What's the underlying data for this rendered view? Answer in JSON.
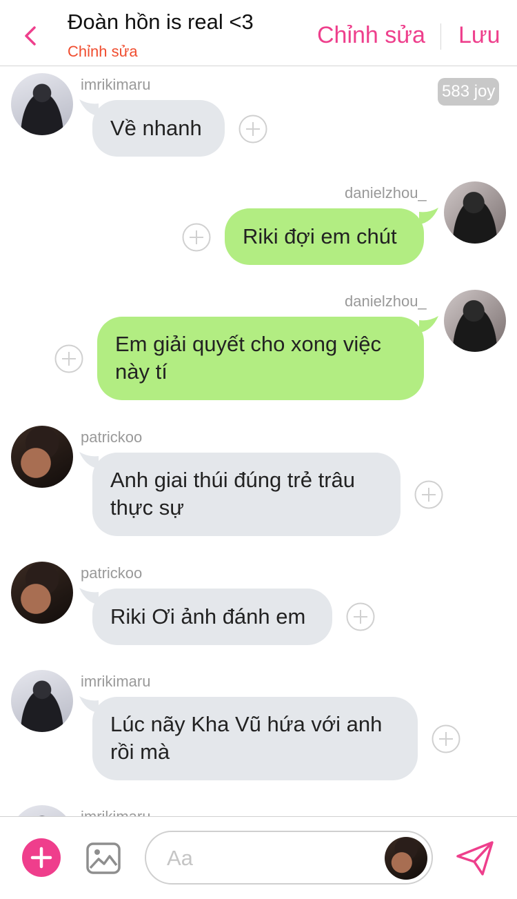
{
  "header": {
    "title": "Đoàn hồn is real <3",
    "subtitle": "Chỉnh sửa",
    "edit_label": "Chỉnh sửa",
    "save_label": "Lưu"
  },
  "badge": {
    "joy": "583 joy"
  },
  "messages": [
    {
      "user": "imrikimaru",
      "side": "left",
      "text_lines": [
        "Về nhanh",
        ""
      ]
    },
    {
      "user": "danielzhou_",
      "side": "right",
      "text_lines": [
        "Riki đợi em chút",
        ""
      ]
    },
    {
      "user": "danielzhou_",
      "side": "right",
      "text_lines": [
        "Em giải quyết cho xong việc",
        "này tí"
      ]
    },
    {
      "user": "patrickoo",
      "side": "left",
      "text_lines": [
        "Anh giai thúi đúng trẻ trâu",
        "thực sự"
      ]
    },
    {
      "user": "patrickoo",
      "side": "left",
      "text_lines": [
        "Riki Ơi ảnh đánh em",
        ""
      ]
    },
    {
      "user": "imrikimaru",
      "side": "left",
      "text_lines": [
        "Lúc nãy Kha Vũ hứa với anh",
        "rồi mà"
      ]
    },
    {
      "user": "imrikimaru",
      "side": "left",
      "text_lines": [
        "",
        ""
      ]
    }
  ],
  "composer": {
    "placeholder": "Aa"
  },
  "colors": {
    "accent_pink": "#ee3f8c",
    "subtitle_red": "#f04d2f",
    "bubble_gray": "#e4e7eb",
    "bubble_green": "#b2ed82"
  },
  "icons": {
    "back": "chevron-left-icon",
    "plus": "plus-circle-icon",
    "add": "plus-icon",
    "image": "image-icon",
    "send": "send-icon"
  }
}
